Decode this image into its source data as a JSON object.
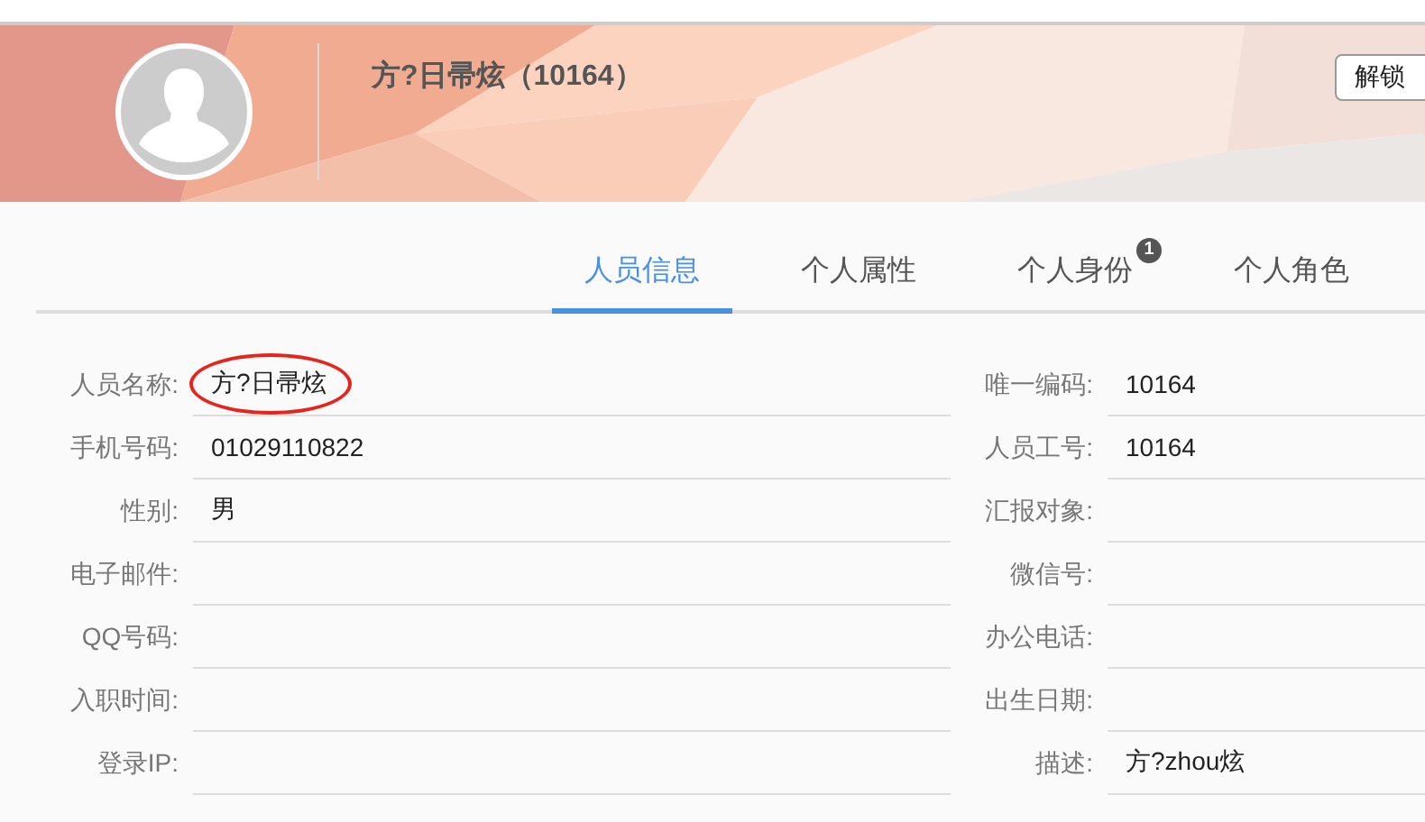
{
  "header": {
    "title": "方?日帚炫（10164）",
    "button": "解锁"
  },
  "tabs": [
    {
      "label": "人员信息",
      "selected": true
    },
    {
      "label": "个人属性",
      "selected": false
    },
    {
      "label": "个人身份",
      "selected": false,
      "badge": "1"
    },
    {
      "label": "个人角色",
      "selected": false
    }
  ],
  "rows": [
    {
      "left": {
        "label": "人员名称:",
        "value": "方?日帚炫",
        "circled": true
      },
      "right": {
        "label": "唯一编码:",
        "value": "10164",
        "circled": false
      }
    },
    {
      "left": {
        "label": "手机号码:",
        "value": "01029110822",
        "circled": false
      },
      "right": {
        "label": "人员工号:",
        "value": "10164",
        "circled": false
      }
    },
    {
      "left": {
        "label": "性别:",
        "value": "男",
        "circled": false
      },
      "right": {
        "label": "汇报对象:",
        "circled": false
      }
    },
    {
      "left": {
        "label": "电子邮件:",
        "circled": false
      },
      "right": {
        "label": "微信号:",
        "circled": false
      }
    },
    {
      "left": {
        "label": "QQ号码:",
        "circled": false
      },
      "right": {
        "label": "办公电话:",
        "circled": false
      }
    },
    {
      "left": {
        "label": "入职时间:",
        "circled": false
      },
      "right": {
        "label": "出生日期:",
        "circled": false
      }
    },
    {
      "left": {
        "label": "登录IP:",
        "circled": false
      },
      "right": {
        "label": "描述:",
        "value": "方?zhou炫",
        "circled": false
      }
    }
  ]
}
